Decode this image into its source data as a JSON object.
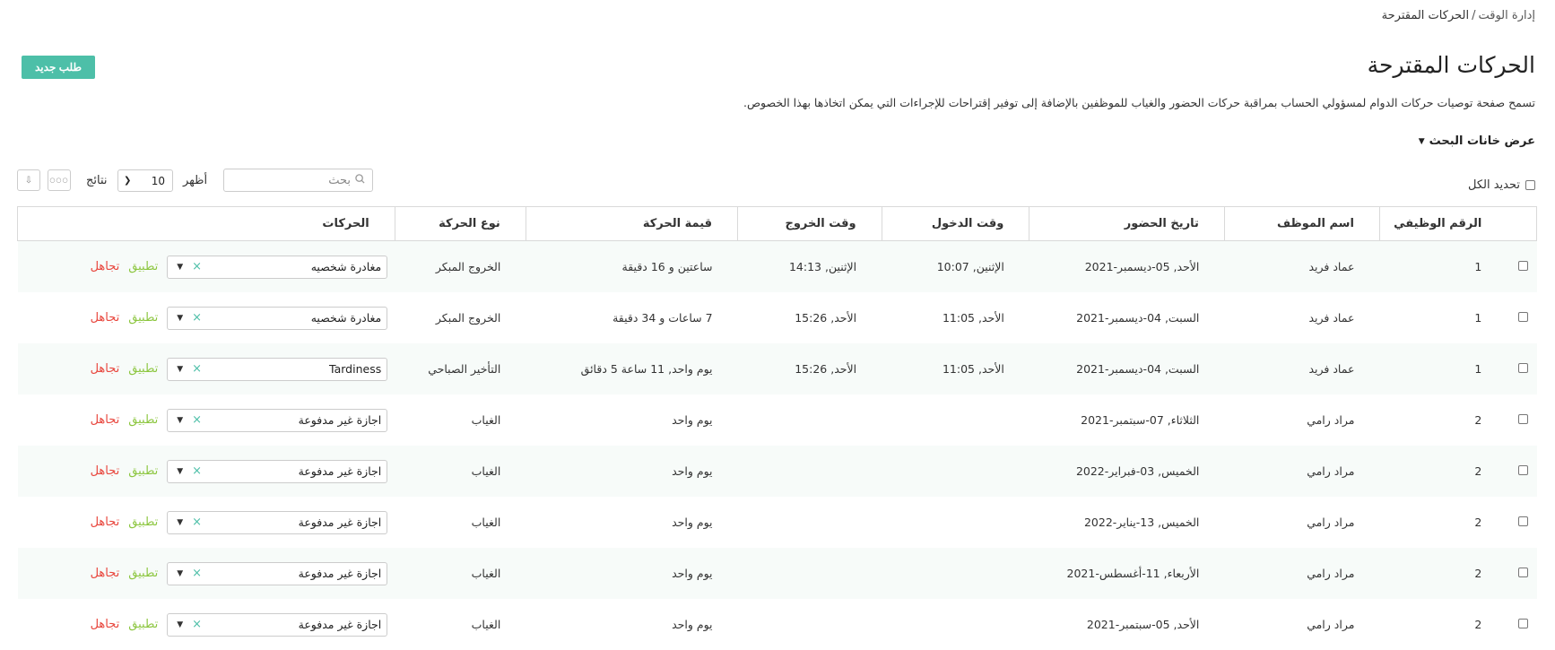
{
  "breadcrumb": {
    "parent": "إدارة الوقت",
    "separator": "/",
    "current": "الحركات المقترحة"
  },
  "header": {
    "title": "الحركات المقترحة",
    "new_request_label": "طلب جديد",
    "description": "تسمح صفحة توصيات حركات الدوام لمسؤولي الحساب بمراقبة حركات الحضور والغياب للموظفين بالإضافة إلى توفير إقتراحات للإجراءات التي يمكن اتخاذها بهذا الخصوص."
  },
  "filters": {
    "toggle_label": "عرض خانات البحث",
    "select_all_label": "تحديد الكل"
  },
  "toolbar": {
    "search_placeholder": "بحث",
    "show_label": "أظهر",
    "page_size": "10",
    "results_label": "نتائج",
    "more_label": "○○○",
    "export_label": "⇩"
  },
  "table": {
    "columns": [
      "الرقم الوظيفي",
      "اسم الموظف",
      "تاريخ الحضور",
      "وقت الدخول",
      "وقت الخروج",
      "قيمة الحركة",
      "نوع الحركة",
      "الحركات"
    ],
    "apply_label": "تطبيق",
    "ignore_label": "تجاهل",
    "rows": [
      {
        "id": "1",
        "name": "عماد فريد",
        "date": "الأحد, 05-ديسمبر-2021",
        "in": "الإثنين, 10:07",
        "out": "الإثنين, 14:13",
        "value": "ساعتين و 16 دقيقة",
        "type": "الخروج المبكر",
        "action": "مغادرة شخصيه"
      },
      {
        "id": "1",
        "name": "عماد فريد",
        "date": "السبت, 04-ديسمبر-2021",
        "in": "الأحد, 11:05",
        "out": "الأحد, 15:26",
        "value": "7 ساعات و 34 دقيقة",
        "type": "الخروج المبكر",
        "action": "مغادرة شخصيه"
      },
      {
        "id": "1",
        "name": "عماد فريد",
        "date": "السبت, 04-ديسمبر-2021",
        "in": "الأحد, 11:05",
        "out": "الأحد, 15:26",
        "value": "يوم واحد, 11 ساعة 5 دقائق",
        "type": "التأخير الصباحي",
        "action": "Tardiness"
      },
      {
        "id": "2",
        "name": "مراد رامي",
        "date": "الثلاثاء, 07-سبتمبر-2021",
        "in": "",
        "out": "",
        "value": "يوم واحد",
        "type": "الغياب",
        "action": "اجازة غير مدفوعة"
      },
      {
        "id": "2",
        "name": "مراد رامي",
        "date": "الخميس, 03-فبراير-2022",
        "in": "",
        "out": "",
        "value": "يوم واحد",
        "type": "الغياب",
        "action": "اجازة غير مدفوعة"
      },
      {
        "id": "2",
        "name": "مراد رامي",
        "date": "الخميس, 13-يناير-2022",
        "in": "",
        "out": "",
        "value": "يوم واحد",
        "type": "الغياب",
        "action": "اجازة غير مدفوعة"
      },
      {
        "id": "2",
        "name": "مراد رامي",
        "date": "الأربعاء, 11-أغسطس-2021",
        "in": "",
        "out": "",
        "value": "يوم واحد",
        "type": "الغياب",
        "action": "اجازة غير مدفوعة"
      },
      {
        "id": "2",
        "name": "مراد رامي",
        "date": "الأحد, 05-سبتمبر-2021",
        "in": "",
        "out": "",
        "value": "يوم واحد",
        "type": "الغياب",
        "action": "اجازة غير مدفوعة"
      }
    ]
  },
  "colors": {
    "accent": "#4dbfa8",
    "apply": "#8cc63f",
    "ignore": "#e8453c",
    "row_stripe": "#f7fbf9"
  }
}
